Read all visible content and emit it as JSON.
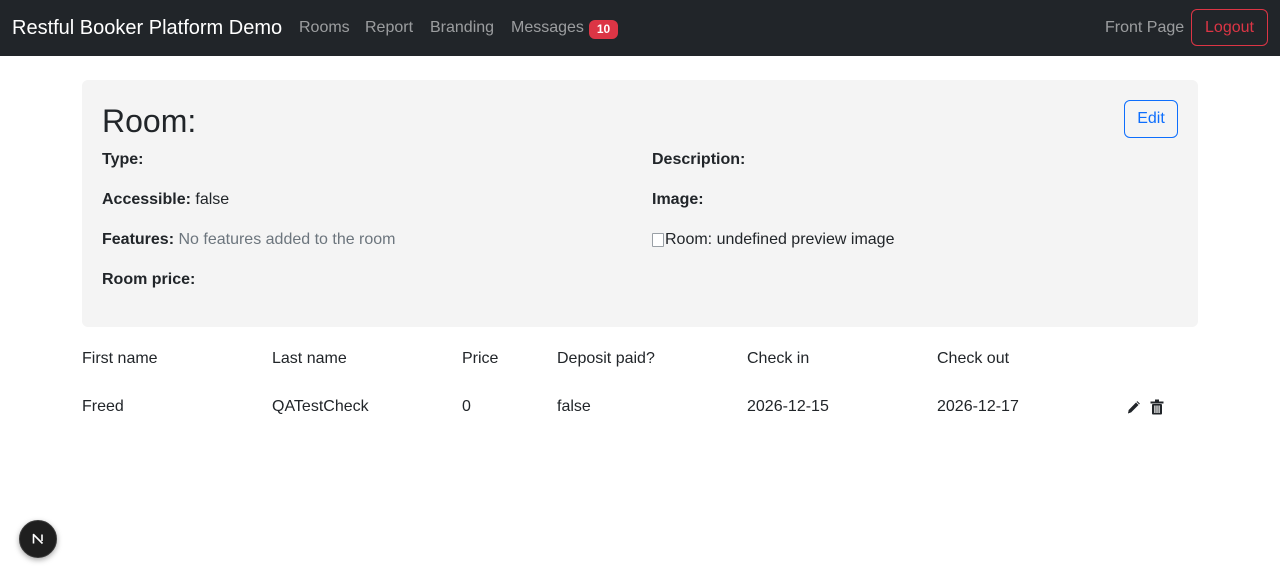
{
  "navbar": {
    "brand": "Restful Booker Platform Demo",
    "links": [
      "Rooms",
      "Report",
      "Branding",
      "Messages"
    ],
    "messages_count": "10",
    "front_page": "Front Page",
    "logout": "Logout"
  },
  "room": {
    "title": "Room:",
    "edit_label": "Edit",
    "type_label": "Type:",
    "type_value": "",
    "accessible_label": "Accessible:",
    "accessible_value": "false",
    "features_label": "Features:",
    "features_value": "No features added to the room",
    "price_label": "Room price:",
    "price_value": "",
    "description_label": "Description:",
    "description_value": "",
    "image_label": "Image:",
    "image_alt": "Room: undefined preview image"
  },
  "bookings": {
    "headers": [
      "First name",
      "Last name",
      "Price",
      "Deposit paid?",
      "Check in",
      "Check out"
    ],
    "rows": [
      [
        "Freed",
        "QATestCheck",
        "0",
        "false",
        "2026-12-15",
        "2026-12-17"
      ]
    ]
  },
  "colors": {
    "navbar_bg": "#212529",
    "danger": "#dc3545",
    "primary": "#0d6efd",
    "card_bg": "#f4f4f4"
  },
  "icons": [
    "pencil-icon",
    "trash-icon",
    "nextjs-icon"
  ]
}
